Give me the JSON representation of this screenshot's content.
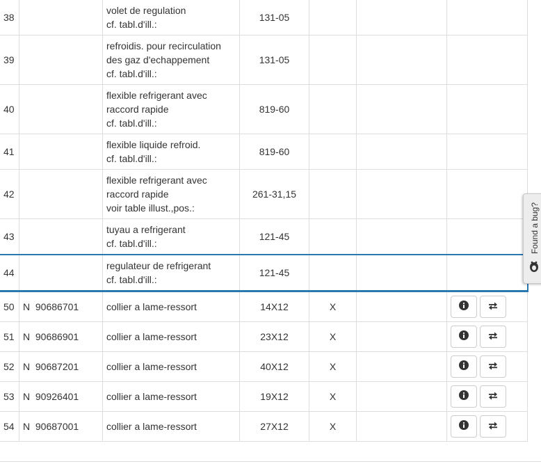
{
  "rows": [
    {
      "pos": "38",
      "ref": "",
      "desc_lines": [
        "volet de regulation",
        "cf. tabl.d'ill.:"
      ],
      "dim": "131-05",
      "mark": ""
    },
    {
      "pos": "39",
      "ref": "",
      "desc_lines": [
        "refroidis. pour recirculation",
        "des gaz d'echappement",
        "cf. tabl.d'ill.:"
      ],
      "dim": "131-05",
      "mark": ""
    },
    {
      "pos": "40",
      "ref": "",
      "desc_lines": [
        "flexible refrigerant avec",
        "raccord rapide",
        "cf. tabl.d'ill.:"
      ],
      "dim": "819-60",
      "mark": ""
    },
    {
      "pos": "41",
      "ref": "",
      "desc_lines": [
        "flexible liquide refroid.",
        "cf. tabl.d'ill.:"
      ],
      "dim": "819-60",
      "mark": ""
    },
    {
      "pos": "42",
      "ref": "",
      "desc_lines": [
        "flexible refrigerant avec",
        "raccord rapide",
        "voir table illust.,pos.:"
      ],
      "dim": "261-31,15",
      "mark": ""
    },
    {
      "pos": "43",
      "ref": "",
      "desc_lines": [
        "tuyau a refrigerant",
        "cf. tabl.d'ill.:"
      ],
      "dim": "121-45",
      "mark": ""
    },
    {
      "pos": "44",
      "ref": "",
      "desc_lines": [
        "regulateur de refrigerant",
        "cf. tabl.d'ill.:"
      ],
      "dim": "121-45",
      "mark": "",
      "highlighted": true
    },
    {
      "pos": "50",
      "ref": "N  90686701",
      "desc_lines": [
        "collier a lame-ressort"
      ],
      "dim": "14X12",
      "mark": "X",
      "has_actions": true
    },
    {
      "pos": "51",
      "ref": "N  90686901",
      "desc_lines": [
        "collier a lame-ressort"
      ],
      "dim": "23X12",
      "mark": "X",
      "has_actions": true
    },
    {
      "pos": "52",
      "ref": "N  90687201",
      "desc_lines": [
        "collier a lame-ressort"
      ],
      "dim": "40X12",
      "mark": "X",
      "has_actions": true
    },
    {
      "pos": "53",
      "ref": "N  90926401",
      "desc_lines": [
        "collier a lame-ressort"
      ],
      "dim": "19X12",
      "mark": "X",
      "has_actions": true
    },
    {
      "pos": "54",
      "ref": "N  90687001",
      "desc_lines": [
        "collier a lame-ressort"
      ],
      "dim": "27X12",
      "mark": "X",
      "has_actions": true
    }
  ],
  "actions": {
    "info_icon": "info-circle-icon",
    "swap_icon": "exchange-arrows-icon"
  },
  "feedback": {
    "label": "Found a bug?",
    "icon": "bug-icon"
  },
  "colors": {
    "highlight": "#2a78b0",
    "border": "#dddddd",
    "text": "#333333"
  }
}
